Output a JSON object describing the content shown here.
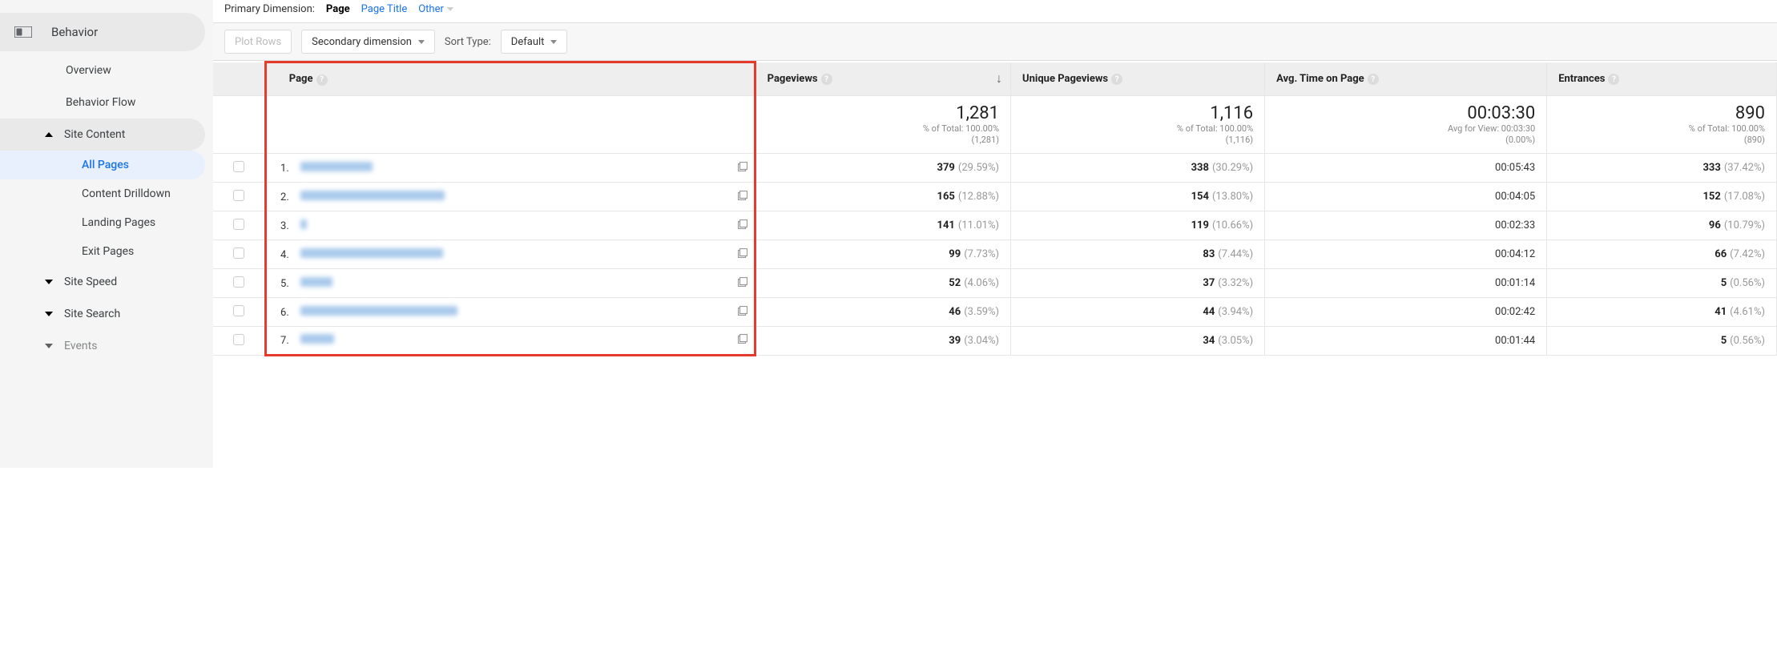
{
  "sidebar": {
    "section": "Behavior",
    "items": [
      "Overview",
      "Behavior Flow"
    ],
    "group": {
      "label": "Site Content",
      "sub": [
        "All Pages",
        "Content Drilldown",
        "Landing Pages",
        "Exit Pages"
      ],
      "activeIndex": 0
    },
    "groups2": [
      "Site Speed",
      "Site Search",
      "Events"
    ]
  },
  "dimensions": {
    "label": "Primary Dimension:",
    "tabs": [
      "Page",
      "Page Title",
      "Other"
    ],
    "activeIndex": 0
  },
  "controls": {
    "plot": "Plot Rows",
    "secondary": "Secondary dimension",
    "sortLabel": "Sort Type:",
    "sortValue": "Default"
  },
  "table": {
    "columns": {
      "page": "Page",
      "pv": "Pageviews",
      "upv": "Unique Pageviews",
      "atop": "Avg. Time on Page",
      "ent": "Entrances"
    },
    "summary": {
      "pv": {
        "big": "1,281",
        "sub1": "% of Total: 100.00%",
        "sub2": "(1,281)"
      },
      "upv": {
        "big": "1,116",
        "sub1": "% of Total: 100.00%",
        "sub2": "(1,116)"
      },
      "atop": {
        "big": "00:03:30",
        "sub1": "Avg for View: 00:03:30",
        "sub2": "(0.00%)"
      },
      "ent": {
        "big": "890",
        "sub1": "% of Total: 100.00%",
        "sub2": "(890)"
      }
    },
    "rows": [
      {
        "n": "1.",
        "blurW": 90,
        "pv": "379",
        "pvp": "(29.59%)",
        "upv": "338",
        "upvp": "(30.29%)",
        "atop": "00:05:43",
        "ent": "333",
        "entp": "(37.42%)"
      },
      {
        "n": "2.",
        "blurW": 180,
        "pv": "165",
        "pvp": "(12.88%)",
        "upv": "154",
        "upvp": "(13.80%)",
        "atop": "00:04:05",
        "ent": "152",
        "entp": "(17.08%)"
      },
      {
        "n": "3.",
        "blurW": 8,
        "pv": "141",
        "pvp": "(11.01%)",
        "upv": "119",
        "upvp": "(10.66%)",
        "atop": "00:02:33",
        "ent": "96",
        "entp": "(10.79%)"
      },
      {
        "n": "4.",
        "blurW": 178,
        "pv": "99",
        "pvp": "(7.73%)",
        "upv": "83",
        "upvp": "(7.44%)",
        "atop": "00:04:12",
        "ent": "66",
        "entp": "(7.42%)"
      },
      {
        "n": "5.",
        "blurW": 40,
        "pv": "52",
        "pvp": "(4.06%)",
        "upv": "37",
        "upvp": "(3.32%)",
        "atop": "00:01:14",
        "ent": "5",
        "entp": "(0.56%)"
      },
      {
        "n": "6.",
        "blurW": 196,
        "pv": "46",
        "pvp": "(3.59%)",
        "upv": "44",
        "upvp": "(3.94%)",
        "atop": "00:02:42",
        "ent": "41",
        "entp": "(4.61%)"
      },
      {
        "n": "7.",
        "blurW": 42,
        "pv": "39",
        "pvp": "(3.04%)",
        "upv": "34",
        "upvp": "(3.05%)",
        "atop": "00:01:44",
        "ent": "5",
        "entp": "(0.56%)"
      }
    ]
  }
}
